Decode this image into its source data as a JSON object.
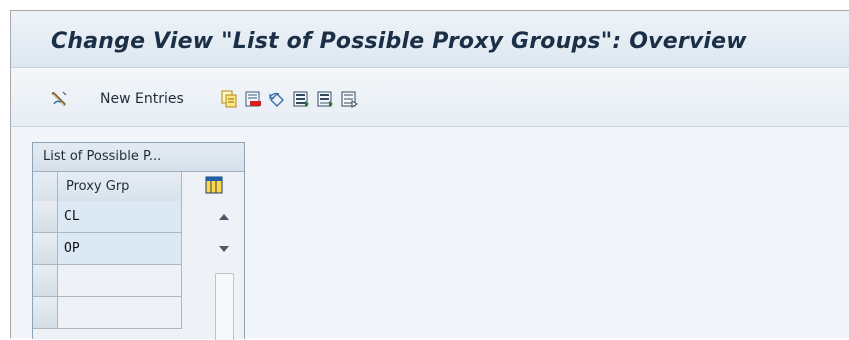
{
  "window": {
    "title": "Change View \"List of Possible Proxy Groups\": Overview"
  },
  "toolbar": {
    "new_entries_label": "New Entries",
    "icons": [
      "edit-display-toggle-icon",
      "copy-as-icon",
      "delete-icon",
      "undo-change-icon",
      "select-all-icon",
      "select-block-icon",
      "deselect-all-icon"
    ]
  },
  "table": {
    "title": "List of Possible P...",
    "column_header": "Proxy Grp",
    "rows": [
      "CL",
      "OP",
      "",
      ""
    ]
  },
  "colors": {
    "title_text": "#1b2f47",
    "row_filled": "#dde8f5",
    "background": "#f1f4f8"
  }
}
